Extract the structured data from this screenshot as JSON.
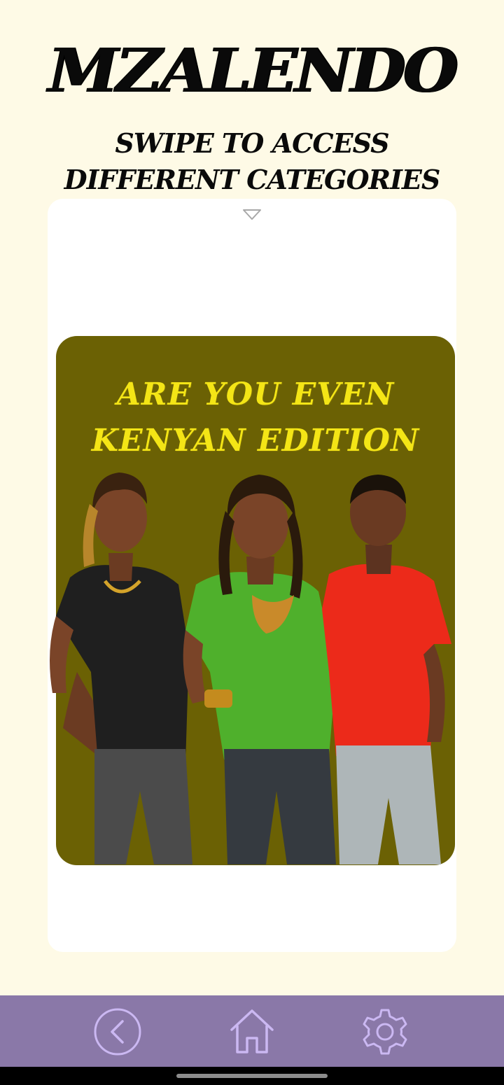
{
  "header": {
    "title": "MZALENDO",
    "subtitle_line1": "SWIPE TO ACCESS",
    "subtitle_line2": "DIFFERENT CATEGORIES"
  },
  "card": {
    "indicator_icon": "chevron-down-icon",
    "poster": {
      "title_line1": "ARE YOU EVEN",
      "title_line2": "KENYAN EDITION",
      "background_color": "#6b6104",
      "title_color": "#f4e516"
    }
  },
  "bottom_nav": {
    "background_color": "#8a78a8",
    "icon_color": "#cbb8f2",
    "items": [
      {
        "icon": "back-icon"
      },
      {
        "icon": "home-icon"
      },
      {
        "icon": "settings-icon"
      }
    ]
  },
  "colors": {
    "page_background": "#fefae6",
    "card_background": "#ffffff"
  }
}
